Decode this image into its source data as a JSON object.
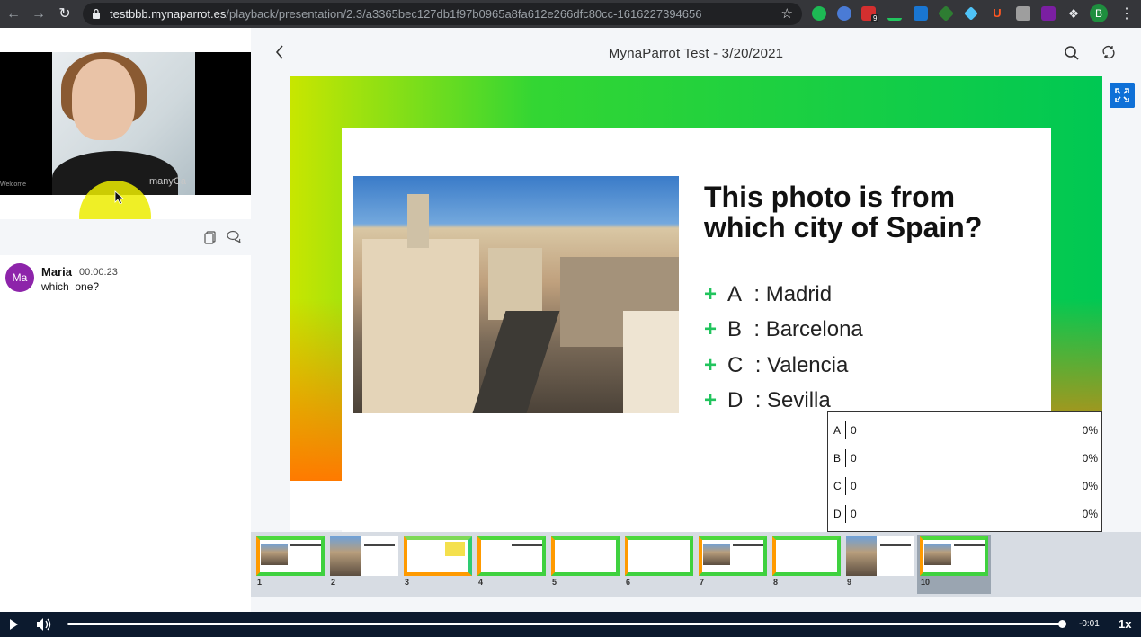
{
  "browser": {
    "url_host": "testbbb.mynaparrot.es",
    "url_path": "/playback/presentation/2.3/a3365bec127db1f97b0965a8fa612e266dfc80cc-1616227394656",
    "extension_badge": "9",
    "profile_initial": "B"
  },
  "video": {
    "watermark": "manyCa",
    "caption": "Welcome"
  },
  "chat": {
    "messages": [
      {
        "avatar": "Ma",
        "name": "Maria",
        "time": "00:00:23",
        "text": "which  one?"
      }
    ]
  },
  "presentation": {
    "title": "MynaParrot Test - 3/20/2021",
    "slide": {
      "question": "This photo is from which city of Spain?",
      "options": [
        {
          "letter": "A",
          "text": "Madrid"
        },
        {
          "letter": "B",
          "text": "Barcelona"
        },
        {
          "letter": "C",
          "text": "Valencia"
        },
        {
          "letter": "D",
          "text": "Sevilla"
        }
      ]
    },
    "poll": [
      {
        "letter": "A",
        "count": "0",
        "percent": "0%"
      },
      {
        "letter": "B",
        "count": "0",
        "percent": "0%"
      },
      {
        "letter": "C",
        "count": "0",
        "percent": "0%"
      },
      {
        "letter": "D",
        "count": "0",
        "percent": "0%"
      }
    ],
    "thumbnails": [
      "1",
      "2",
      "3",
      "4",
      "5",
      "6",
      "7",
      "8",
      "9",
      "10"
    ],
    "active_thumbnail": "10"
  },
  "player": {
    "time_remaining": "-0:01",
    "speed": "1x",
    "progress": 0.999
  },
  "colors": {
    "accent_blue": "#0f70d7",
    "chat_avatar": "#8d24aa",
    "option_plus": "#21c45d",
    "player_bg": "#0c1a2e"
  }
}
